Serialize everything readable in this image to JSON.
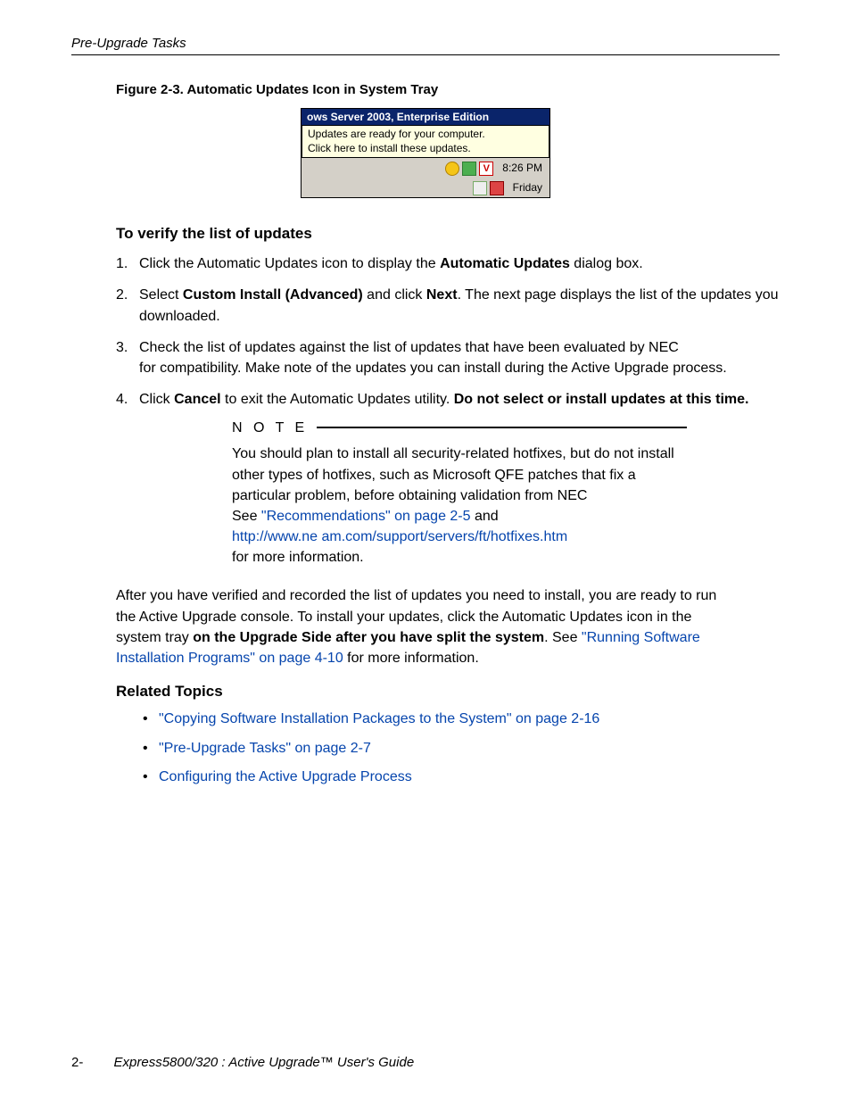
{
  "header": {
    "section": "Pre-Upgrade Tasks"
  },
  "figure": {
    "caption": "Figure 2-3. Automatic Updates Icon in System Tray",
    "titlebar": "ows Server 2003, Enterprise Edition",
    "balloon_line1": "Updates are ready for your computer.",
    "balloon_line2": "Click here to install these updates.",
    "time": "8:26 PM",
    "day": "Friday"
  },
  "verify": {
    "heading": "To verify the list of updates",
    "steps": [
      {
        "n": "1.",
        "pre": "Click the Automatic Updates icon to display the ",
        "bold1": "Automatic Updates",
        "post1": " dialog box."
      },
      {
        "n": "2.",
        "pre": "Select ",
        "bold1": "Custom Install (Advanced)",
        "mid": " and click ",
        "bold2": "Next",
        "post": ". The next page displays the list of the updates you downloaded."
      },
      {
        "n": "3.",
        "text": "Check the list of updates against the list of updates that have been evaluated by NEC                                             for compatibility. Make note of the updates you can install during the Active Upgrade process."
      },
      {
        "n": "4.",
        "pre": "Click ",
        "bold1": "Cancel",
        "mid": " to exit the Automatic Updates utility. ",
        "bold2": "Do not select or install updates at this time."
      }
    ]
  },
  "note": {
    "label": "N O T E",
    "body_pre": "You should plan to install all security-related hotfixes, but do not install other types of hotfixes, such as Microsoft QFE patches that fix a particular problem, before obtaining validation from NEC",
    "body_see": "See ",
    "link1": "\"Recommendations\" on page 2-5",
    "body_and": " and ",
    "link2": "http://www.ne  am.com/support/servers/ft/hotfixes.htm",
    "body_post": " for more information."
  },
  "after": {
    "pre": "After you have verified and recorded the list of updates you need to install, you are ready to run the Active Upgrade console. To install your updates, click the Automatic Updates icon in the system tray ",
    "bold": "on the Upgrade Side after you have split the system",
    "mid": ". See ",
    "link": "\"Running Software Installation Programs\" on page 4-10",
    "post": " for more information."
  },
  "related": {
    "heading": "Related Topics",
    "items": [
      "\"Copying Software Installation Packages to the System\" on page 2-16",
      "\"Pre-Upgrade Tasks\" on page 2-7",
      "Configuring the Active Upgrade Process"
    ]
  },
  "footer": {
    "page": "2-",
    "book": "Express5800/320   : Active Upgrade™ User's Guide"
  }
}
